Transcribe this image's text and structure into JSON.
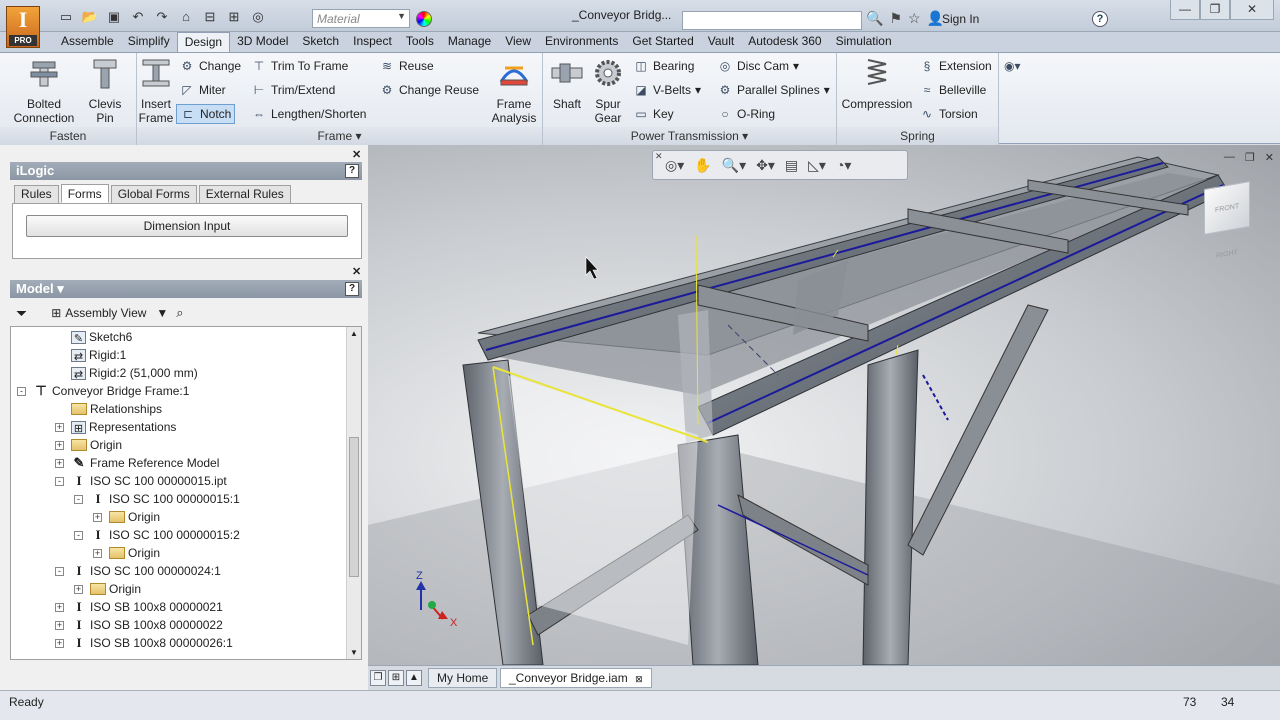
{
  "app": {
    "badge": "I",
    "edition": "PRO",
    "document_title": "_Conveyor Bridg...",
    "material_placeholder": "Material",
    "sign_in": "Sign In",
    "help": "?"
  },
  "ribbon_tabs": [
    "Assemble",
    "Simplify",
    "Design",
    "3D Model",
    "Sketch",
    "Inspect",
    "Tools",
    "Manage",
    "View",
    "Environments",
    "Get Started",
    "Vault",
    "Autodesk 360",
    "Simulation"
  ],
  "ribbon": {
    "fasten": {
      "label": "Fasten",
      "bolted": "Bolted",
      "connection": "Connection",
      "clevis": "Clevis",
      "pin": "Pin"
    },
    "frame": {
      "label": "Frame",
      "insert": "Insert",
      "frame": "Frame",
      "change": "Change",
      "miter": "Miter",
      "notch": "Notch",
      "trim_to_frame": "Trim To Frame",
      "trim_extend": "Trim/Extend",
      "lengthen_shorten": "Lengthen/Shorten",
      "reuse": "Reuse",
      "change_reuse": "Change Reuse",
      "frame_analysis_1": "Frame",
      "frame_analysis_2": "Analysis"
    },
    "power": {
      "label": "Power Transmission",
      "shaft": "Shaft",
      "spur": "Spur",
      "gear": "Gear",
      "bearing": "Bearing",
      "vbelts": "V-Belts",
      "key": "Key",
      "disc_cam": "Disc Cam",
      "parallel_splines": "Parallel Splines",
      "oring": "O-Ring"
    },
    "spring": {
      "label": "Spring",
      "compression": "Compression",
      "extension": "Extension",
      "belleville": "Belleville",
      "torsion": "Torsion"
    }
  },
  "ilogic": {
    "title": "iLogic",
    "tabs": [
      "Rules",
      "Forms",
      "Global Forms",
      "External Rules"
    ],
    "active_tab": "Forms",
    "button": "Dimension Input"
  },
  "model": {
    "title": "Model",
    "view": "Assembly View",
    "tree": [
      {
        "label": "Sketch6",
        "indent": 2,
        "icon": "sketch",
        "exp": ""
      },
      {
        "label": "Rigid:1",
        "indent": 2,
        "icon": "constraint",
        "exp": ""
      },
      {
        "label": "Rigid:2 (51,000 mm)",
        "indent": 2,
        "icon": "constraint",
        "exp": ""
      },
      {
        "label": "Conveyor Bridge Frame:1",
        "indent": 0,
        "icon": "assembly",
        "exp": "-"
      },
      {
        "label": "Relationships",
        "indent": 2,
        "icon": "folder",
        "exp": ""
      },
      {
        "label": "Representations",
        "indent": 2,
        "icon": "representations",
        "exp": "+"
      },
      {
        "label": "Origin",
        "indent": 2,
        "icon": "folder",
        "exp": "+"
      },
      {
        "label": "Frame Reference Model",
        "indent": 2,
        "icon": "reference",
        "exp": "+"
      },
      {
        "label": "ISO SC 100 00000015.ipt",
        "indent": 2,
        "icon": "part",
        "exp": "-"
      },
      {
        "label": "ISO SC 100 00000015:1",
        "indent": 3,
        "icon": "part",
        "exp": "-"
      },
      {
        "label": "Origin",
        "indent": 4,
        "icon": "folder",
        "exp": "+"
      },
      {
        "label": "ISO SC 100 00000015:2",
        "indent": 3,
        "icon": "part",
        "exp": "-"
      },
      {
        "label": "Origin",
        "indent": 4,
        "icon": "folder",
        "exp": "+"
      },
      {
        "label": "ISO SC 100 00000024:1",
        "indent": 2,
        "icon": "part",
        "exp": "-"
      },
      {
        "label": "Origin",
        "indent": 3,
        "icon": "folder",
        "exp": "+"
      },
      {
        "label": "ISO SB 100x8 00000021",
        "indent": 2,
        "icon": "part",
        "exp": "+"
      },
      {
        "label": "ISO SB 100x8 00000022",
        "indent": 2,
        "icon": "part",
        "exp": "+"
      },
      {
        "label": "ISO SB 100x8 00000026:1",
        "indent": 2,
        "icon": "part",
        "exp": "+"
      }
    ]
  },
  "viewport": {
    "viewcube_front": "FRONT",
    "viewcube_right": "RIGHT",
    "axis_x": "X",
    "axis_z": "Z"
  },
  "document_tabs": [
    "My Home",
    "_Conveyor Bridge.iam"
  ],
  "status": {
    "text": "Ready",
    "value1": "73",
    "value2": "34"
  },
  "colors": {
    "frame_highlight": "#e8e43a",
    "edge_blue": "#1a1a9a",
    "app_orange": "#e07a22"
  }
}
